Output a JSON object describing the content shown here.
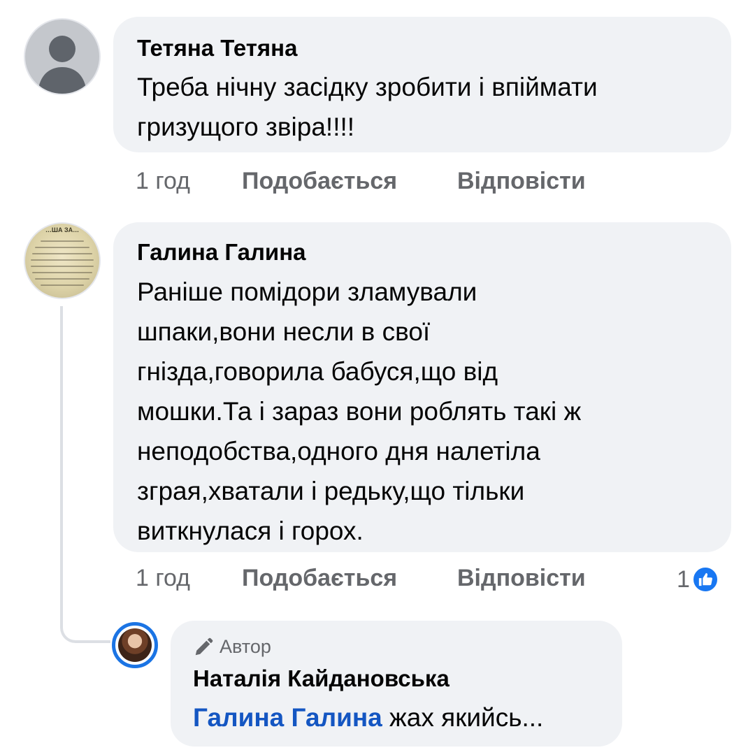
{
  "comments": [
    {
      "author": "Тетяна Тетяна",
      "text": "Треба нічну засідку зробити і впіймати\nгризущого звіра!!!!",
      "time": "1 год",
      "like_label": "Подобається",
      "reply_label": "Відповісти"
    },
    {
      "author": "Галина Галина",
      "text": "Раніше помідори зламували\nшпаки,вони несли в свої\nгнізда,говорила бабуся,що від\nмошки.Та і зараз вони роблять такі ж\nнеподобства,одного дня налетіла\nзграя,хватали і редьку,що тільки\nвиткнулася і горох.",
      "time": "1 год",
      "like_label": "Подобається",
      "reply_label": "Відповісти",
      "reaction_count": "1",
      "avatar_text": "…ША ЗА…"
    }
  ],
  "reply": {
    "badge": "Автор",
    "author": "Наталія Кайдановська",
    "mention": "Галина Галина",
    "text": "жах якийсь..."
  },
  "icons": {
    "default_avatar": "default-person-icon",
    "author_badge": "pencil-icon",
    "reaction": "thumbs-up-icon"
  },
  "colors": {
    "bubble": "#f0f2f5",
    "meta_text": "#65676b",
    "accent_blue": "#1877f2",
    "mention_blue": "#1456c2"
  }
}
